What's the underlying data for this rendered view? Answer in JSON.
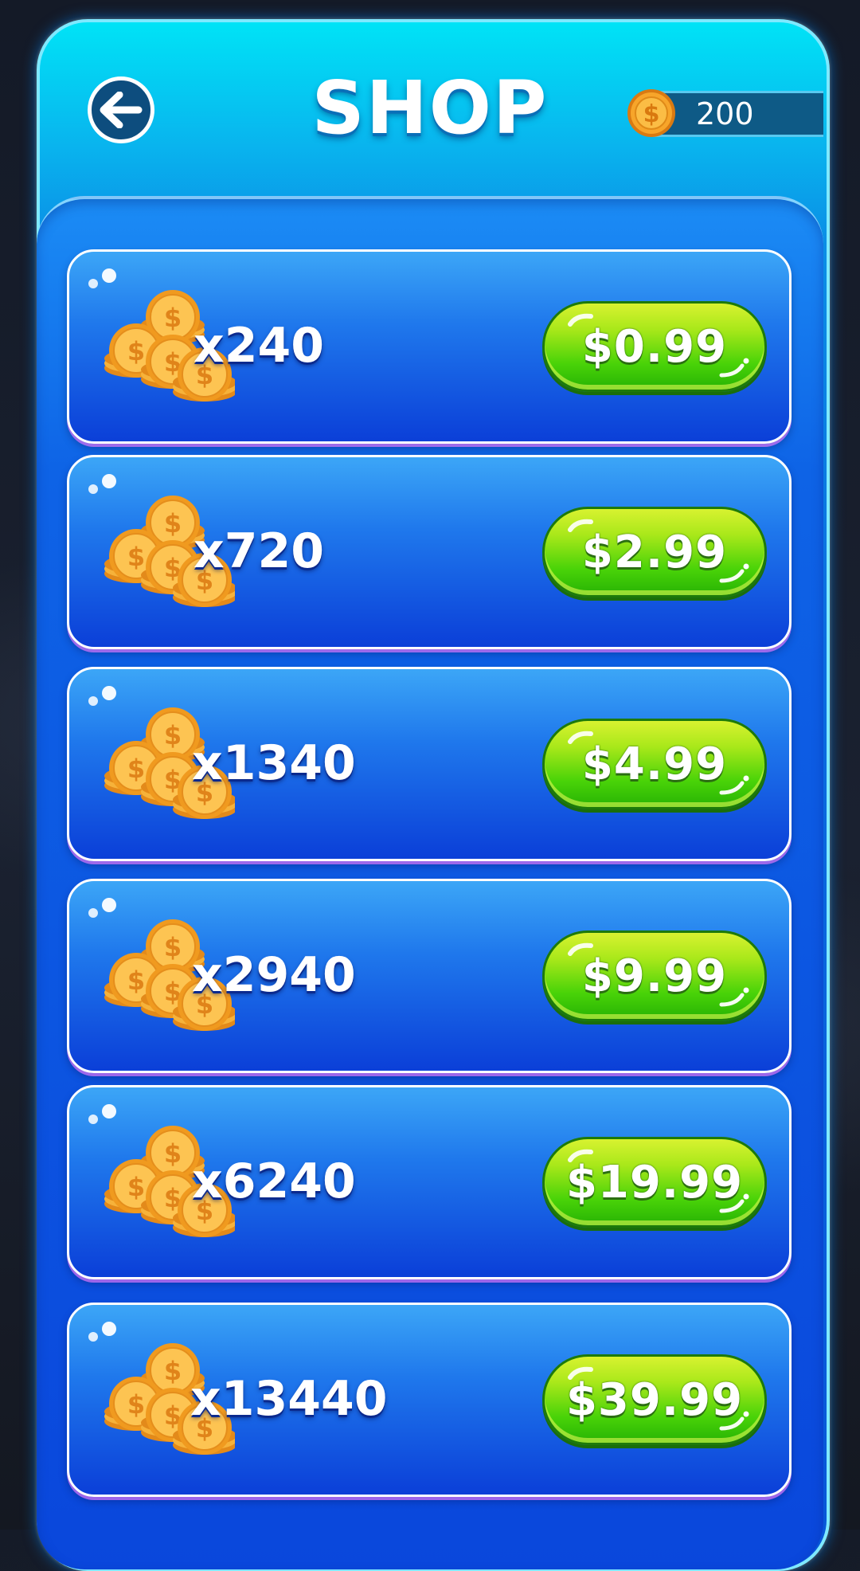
{
  "header": {
    "title": "SHOP",
    "back_icon": "arrow-left-icon",
    "coin_balance": "200",
    "balance_icon": "coin-icon"
  },
  "offers": [
    {
      "amount": "x240",
      "price": "$0.99"
    },
    {
      "amount": "x720",
      "price": "$2.99"
    },
    {
      "amount": "x1340",
      "price": "$4.99"
    },
    {
      "amount": "x2940",
      "price": "$9.99"
    },
    {
      "amount": "x6240",
      "price": "$19.99"
    },
    {
      "amount": "x13440",
      "price": "$39.99"
    }
  ],
  "colors": {
    "panel_top": "#00e3f6",
    "panel_body": "#0a47dc",
    "buy_button": "#49d308",
    "coin_gold": "#f5a623"
  }
}
